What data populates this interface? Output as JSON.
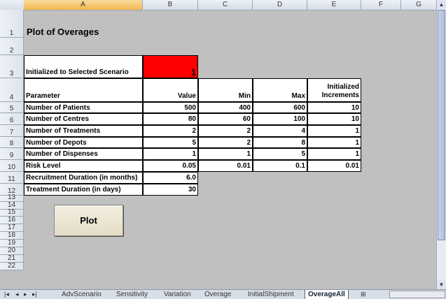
{
  "columns": [
    "A",
    "B",
    "C",
    "D",
    "E",
    "F",
    "G"
  ],
  "rows": [
    "1",
    "2",
    "3",
    "4",
    "5",
    "6",
    "7",
    "8",
    "9",
    "10",
    "11",
    "12",
    "13",
    "14",
    "15",
    "16",
    "17",
    "18",
    "19",
    "20",
    "21",
    "22"
  ],
  "title": "Plot of Overages",
  "scenario": {
    "label": "Initialized to Selected Scenario",
    "value": "1",
    "value_color": "#ff0000"
  },
  "headers": {
    "parameter": "Parameter",
    "value": "Value",
    "min": "Min",
    "max": "Max",
    "increments": "Initialized Increments"
  },
  "table": [
    {
      "name": "Number of Patients",
      "value": "500",
      "min": "400",
      "max": "600",
      "inc": "10"
    },
    {
      "name": "Number of Centres",
      "value": "80",
      "min": "60",
      "max": "100",
      "inc": "10"
    },
    {
      "name": "Number of Treatments",
      "value": "2",
      "min": "2",
      "max": "4",
      "inc": "1"
    },
    {
      "name": "Number of Depots",
      "value": "5",
      "min": "2",
      "max": "8",
      "inc": "1"
    },
    {
      "name": "Number of Dispenses",
      "value": "1",
      "min": "1",
      "max": "5",
      "inc": "1"
    },
    {
      "name": "Risk Level",
      "value": "0.05",
      "min": "0.01",
      "max": "0.1",
      "inc": "0.01"
    }
  ],
  "extra": [
    {
      "name": "Recruitment Duration (in months)",
      "value": "6.0"
    },
    {
      "name": "Treatment Duration (in days)",
      "value": "30"
    }
  ],
  "plot_button": "Plot",
  "sheet_tabs": [
    "AdvScenario",
    "Sensitivity",
    "Variation",
    "Overage",
    "InitialShipment",
    "OverageAll"
  ],
  "active_tab": "OverageAll"
}
